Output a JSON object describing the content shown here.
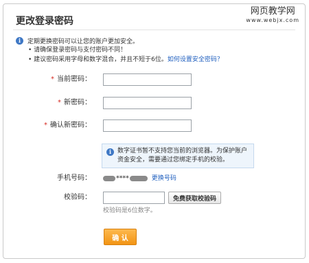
{
  "header": {
    "title": "更改登录密码",
    "watermark_line1": "网页教学网",
    "watermark_line2": "www.webjx.com"
  },
  "notice": {
    "icon": "info-icon",
    "lead": "定期更换密码可以让您的账户更加安全。",
    "bullet1": "请确保登录密码与支付密码不同！",
    "bullet2_text": "建议密码采用字母和数字混合，并且不短于6位。",
    "bullet2_link": "如何设置安全密码？"
  },
  "form": {
    "required_mark": "*",
    "current_password_label": "当前密码：",
    "new_password_label": "新密码：",
    "confirm_password_label": "确认新密码：",
    "current_password_value": "",
    "new_password_value": "",
    "confirm_password_value": ""
  },
  "tip": {
    "icon": "info-icon",
    "line1": "数字证书暂不支持您当前的浏览器。为保护账户",
    "line2": "资金安全，需要通过您绑定手机的校验。"
  },
  "phone": {
    "label": "手机号码：",
    "masked_stars": "****",
    "change_link": "更换号码"
  },
  "verify": {
    "label": "校验码：",
    "value": "",
    "get_code_button": "免费获取校验码",
    "hint": "校验码是6位数字。"
  },
  "confirm_button": "确 认",
  "colors": {
    "accent_orange": "#f29414",
    "link_blue": "#1f5fbf",
    "required_red": "#d62a21",
    "info_blue": "#3f78c5"
  }
}
